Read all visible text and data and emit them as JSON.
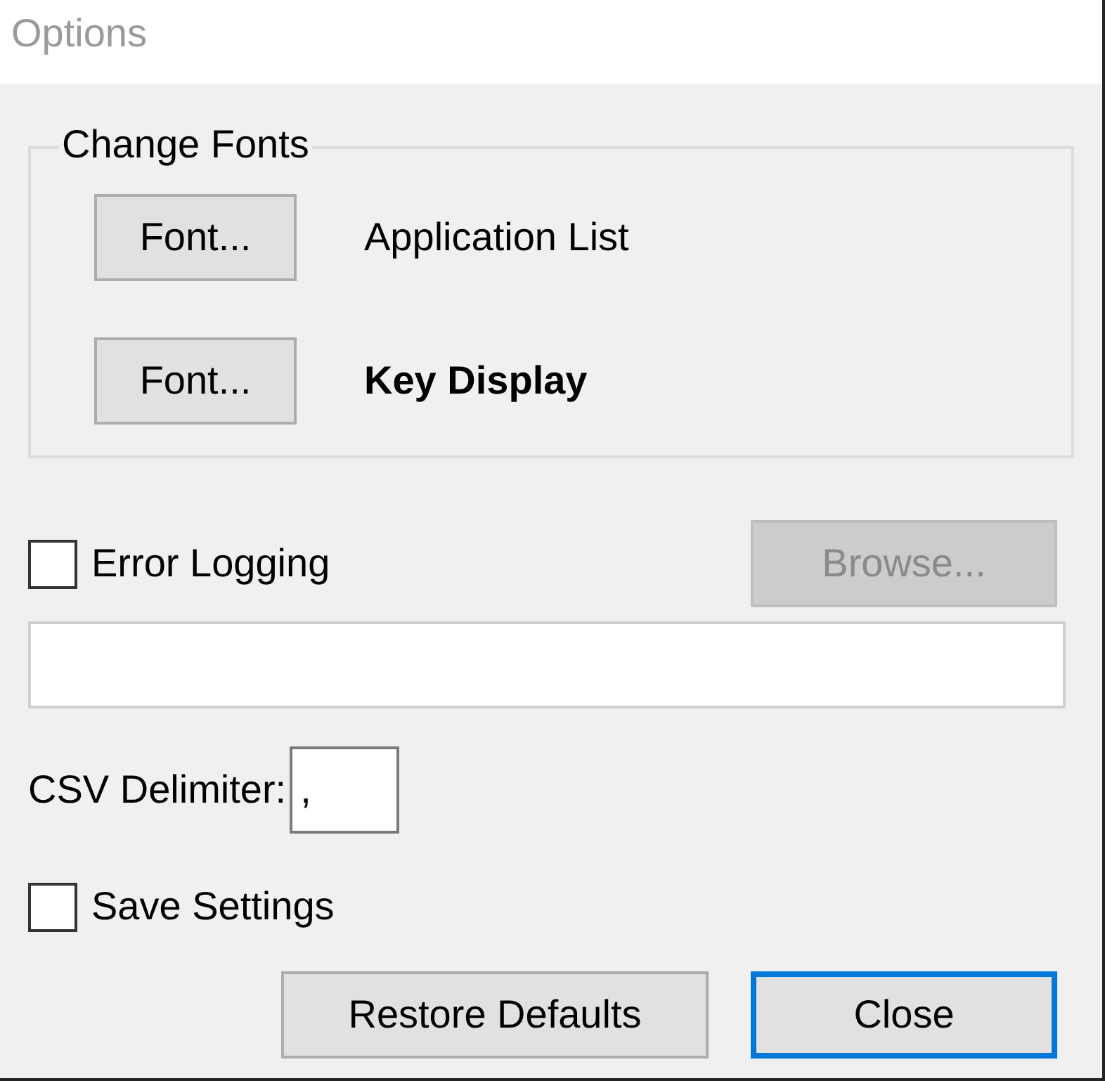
{
  "window": {
    "title": "Options"
  },
  "font_group": {
    "title": "Change Fonts",
    "rows": [
      {
        "button": "Font...",
        "label": "Application List",
        "bold": false
      },
      {
        "button": "Font...",
        "label": "Key Display",
        "bold": true
      }
    ]
  },
  "error_logging": {
    "label": "Error Logging",
    "checked": false,
    "browse": {
      "label": "Browse...",
      "disabled": true
    }
  },
  "csv_delimiter": {
    "label": "CSV Delimiter:",
    "value": ","
  },
  "save_settings": {
    "label": "Save Settings",
    "checked": false
  },
  "buttons": [
    {
      "label": "Restore Defaults",
      "default": false
    },
    {
      "label": "Close",
      "default": true
    }
  ]
}
